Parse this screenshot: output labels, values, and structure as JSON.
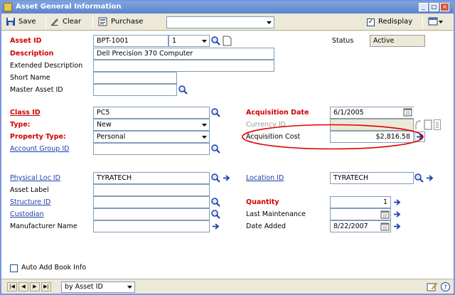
{
  "window": {
    "title": "Asset General Information"
  },
  "toolbar": {
    "save": "Save",
    "clear": "Clear",
    "purchase": "Purchase",
    "dropdown_value": "",
    "redisplay": "Redisplay",
    "redisplay_checked": true
  },
  "fields": {
    "asset_id": {
      "label": "Asset ID",
      "value": "BPT-1001",
      "suffix": "1"
    },
    "status": {
      "label": "Status",
      "value": "Active"
    },
    "description": {
      "label": "Description",
      "value": "Dell Precision 370 Computer"
    },
    "extended_description": {
      "label": "Extended Description",
      "value": ""
    },
    "short_name": {
      "label": "Short Name",
      "value": ""
    },
    "master_asset_id": {
      "label": "Master Asset ID",
      "value": ""
    },
    "class_id": {
      "label": "Class ID",
      "value": "PC5"
    },
    "type": {
      "label": "Type:",
      "value": "New"
    },
    "property_type": {
      "label": "Property Type:",
      "value": "Personal"
    },
    "account_group_id": {
      "label": "Account Group ID",
      "value": ""
    },
    "acquisition_date": {
      "label": "Acquisition Date",
      "value": "6/1/2005"
    },
    "currency_id": {
      "label": "Currency ID",
      "value": ""
    },
    "acquisition_cost": {
      "label": "Acquisition Cost",
      "value": "$2,816.58"
    },
    "physical_loc_id": {
      "label": "Physical Loc ID",
      "value": "TYRATECH"
    },
    "asset_label": {
      "label": "Asset Label",
      "value": ""
    },
    "structure_id": {
      "label": "Structure ID",
      "value": ""
    },
    "custodian": {
      "label": "Custodian",
      "value": ""
    },
    "manufacturer_name": {
      "label": "Manufacturer Name",
      "value": ""
    },
    "location_id": {
      "label": "Location ID",
      "value": "TYRATECH"
    },
    "quantity": {
      "label": "Quantity",
      "value": "1"
    },
    "last_maintenance": {
      "label": "Last Maintenance",
      "value": ""
    },
    "date_added": {
      "label": "Date Added",
      "value": "8/22/2007"
    }
  },
  "auto_add_book_info": {
    "label": "Auto Add Book Info",
    "checked": false
  },
  "statusbar": {
    "sort_value": "by Asset ID"
  },
  "colors": {
    "required": "#d00000",
    "link": "#1a3fa8",
    "highlight": "#e00000",
    "title_bar": "#5b84cf"
  }
}
